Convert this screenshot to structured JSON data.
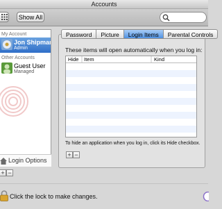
{
  "window": {
    "title": "Accounts"
  },
  "toolbar": {
    "show_all_label": "Show All",
    "search_placeholder": ""
  },
  "sidebar": {
    "my_account_header": "My Account",
    "other_accounts_header": "Other Accounts",
    "users": [
      {
        "name": "Jon Shipman",
        "role": "Admin"
      },
      {
        "name": "Guest User",
        "role": "Managed"
      }
    ],
    "login_options_label": "Login Options"
  },
  "tabs": [
    "Password",
    "Picture",
    "Login Items",
    "Parental Controls"
  ],
  "active_tab": "Login Items",
  "login_items": {
    "intro": "These items will open automatically when you log in:",
    "columns": [
      "Hide",
      "Item",
      "Kind"
    ],
    "rows": [],
    "hint": "To hide an application when you log in, click its Hide checkbox.",
    "add_label": "+",
    "remove_label": "−"
  },
  "footer": {
    "lock_text": "Click the lock to make changes."
  },
  "colors": {
    "selection": "#2f6ec8",
    "active_tab": "#4f92e3",
    "stripe": "#edf3fe"
  }
}
